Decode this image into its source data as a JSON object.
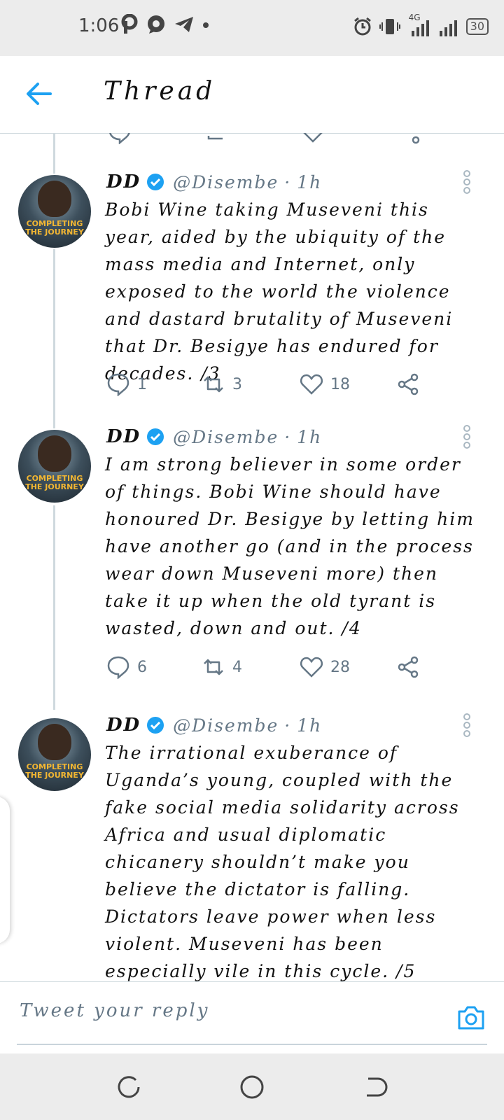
{
  "status_bar": {
    "time": "1:06",
    "left_icons": [
      "pinterest-icon",
      "whatsapp-icon",
      "telegram-icon",
      "dot-icon"
    ],
    "right_icons": [
      "alarm-icon",
      "vibrate-icon",
      "signal-4g-icon",
      "signal-icon"
    ],
    "network_label": "4G",
    "battery": "30"
  },
  "header": {
    "title": "Thread",
    "back_icon": "arrow-left-icon",
    "accent": "#1da1f2"
  },
  "tweets": [
    {
      "name": "DD",
      "handle": "@Disembe",
      "time": "1h",
      "text": "Bobi Wine taking Museveni this year, aided by the ubiquity of the mass media and Internet, only exposed to the world the violence and dastard brutality of Museveni that Dr. Besigye has endured for decades. /3",
      "replies": "1",
      "retweets": "3",
      "likes": "18",
      "avatar_text": [
        "COMPLETING",
        "THE JOURNEY"
      ]
    },
    {
      "name": "DD",
      "handle": "@Disembe",
      "time": "1h",
      "text": "I am strong believer in some  order of things. Bobi Wine should have honoured Dr. Besigye by letting him have another go (and in the process wear down Museveni more) then take it up when the old tyrant is wasted, down and out. /4",
      "replies": "6",
      "retweets": "4",
      "likes": "28",
      "avatar_text": [
        "COMPLETING",
        "THE JOURNEY"
      ]
    },
    {
      "name": "DD",
      "handle": "@Disembe",
      "time": "1h",
      "text": "The irrational exuberance of Uganda’s young, coupled with the fake social media solidarity across Africa and usual diplomatic chicanery shouldn’t make you believe the dictator is falling. Dictators leave power when less violent. Museveni has been especially vile in this cycle. /5",
      "avatar_text": [
        "COMPLETING",
        "THE JOURNEY"
      ]
    }
  ],
  "reply": {
    "placeholder": "Tweet your reply",
    "camera_icon": "camera-icon"
  },
  "nav": {
    "icons": [
      "recent-apps-icon",
      "home-icon",
      "back-icon"
    ]
  }
}
